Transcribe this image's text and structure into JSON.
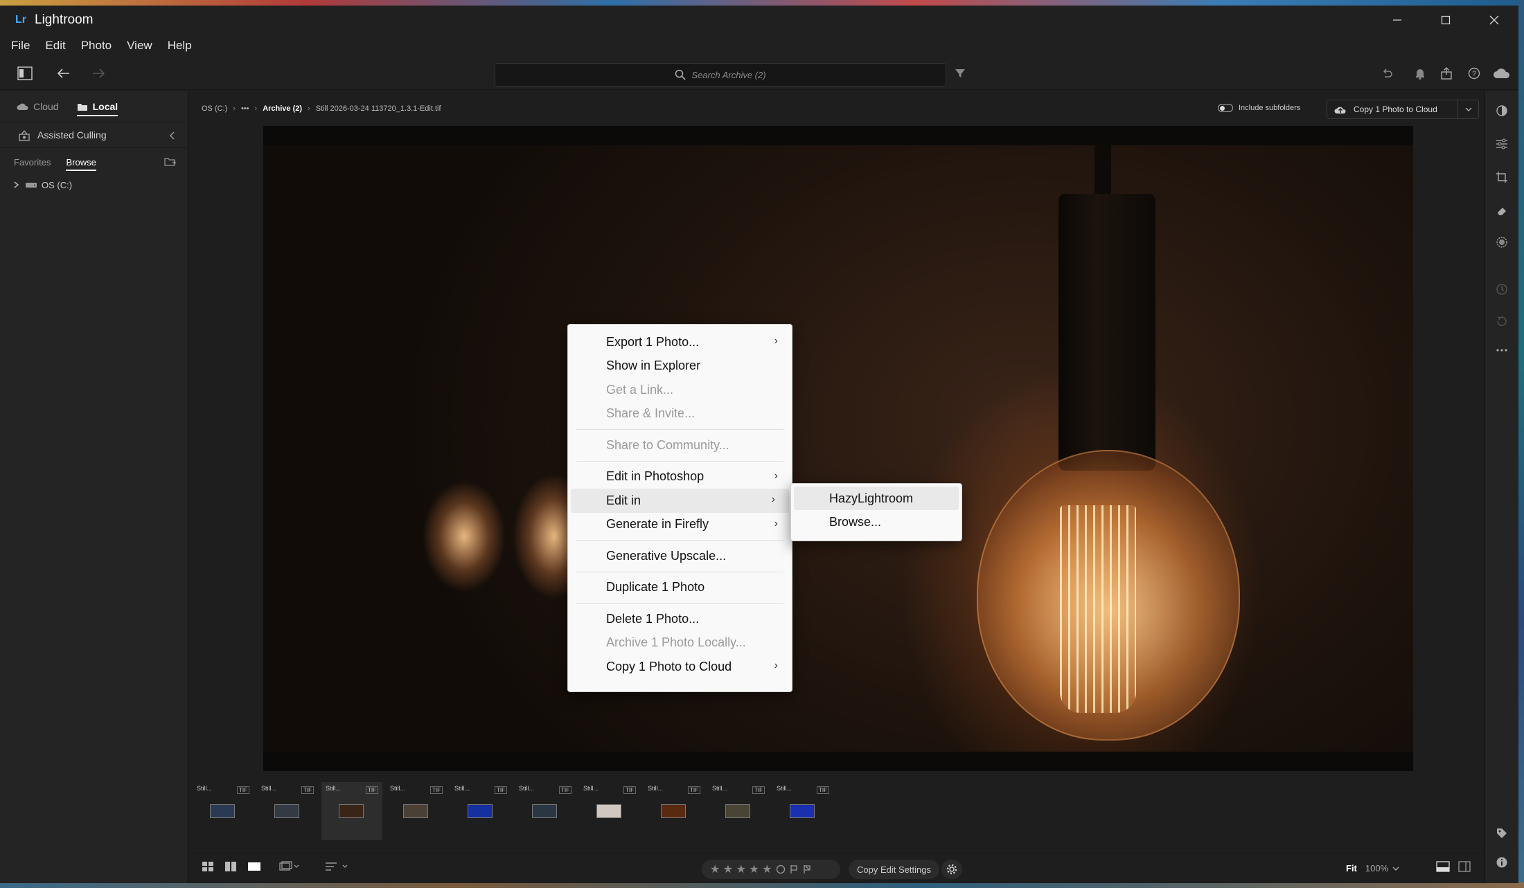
{
  "app": {
    "title": "Lightroom",
    "logo": "Lr"
  },
  "menu": [
    "File",
    "Edit",
    "Photo",
    "View",
    "Help"
  ],
  "search": {
    "placeholder": "Search Archive (2)"
  },
  "left_panel": {
    "tabs": {
      "cloud": "Cloud",
      "local": "Local"
    },
    "assisted_culling": "Assisted Culling",
    "browser_tabs": {
      "favorites": "Favorites",
      "browse": "Browse"
    },
    "tree": {
      "drive": "OS (C:)"
    }
  },
  "breadcrumb": {
    "root": "OS (C:)",
    "more": "•••",
    "folder": "Archive (2)",
    "file": "Still 2026-03-24 113720_1.3.1-Edit.tif"
  },
  "header": {
    "include_subfolders": "Include subfolders",
    "copy_to_cloud": "Copy 1 Photo to Cloud"
  },
  "context_menu": {
    "items": [
      {
        "label": "Export 1 Photo...",
        "submenu": true,
        "disabled": false
      },
      {
        "label": "Show in Explorer",
        "disabled": false
      },
      {
        "label": "Get a Link...",
        "disabled": true
      },
      {
        "label": "Share & Invite...",
        "disabled": true
      },
      {
        "label": "Share to Community...",
        "disabled": true
      },
      {
        "label": "Edit in Photoshop",
        "submenu": true,
        "disabled": false
      },
      {
        "label": "Edit in",
        "submenu": true,
        "disabled": false,
        "highlighted": true
      },
      {
        "label": "Generate in Firefly",
        "submenu": true,
        "disabled": false
      },
      {
        "label": "Generative Upscale...",
        "disabled": false
      },
      {
        "label": "Duplicate 1 Photo",
        "disabled": false
      },
      {
        "label": "Delete 1 Photo...",
        "disabled": false
      },
      {
        "label": "Archive 1 Photo Locally...",
        "disabled": true
      },
      {
        "label": "Copy 1 Photo to Cloud",
        "submenu": true,
        "disabled": false
      }
    ]
  },
  "submenu": {
    "items": [
      {
        "label": "HazyLightroom",
        "highlighted": true
      },
      {
        "label": "Browse..."
      }
    ]
  },
  "filmstrip": {
    "thumbs": [
      {
        "name": "Still...",
        "type": "TIF",
        "color": "#2a3a55"
      },
      {
        "name": "Still...",
        "type": "TIF",
        "color": "#333a44"
      },
      {
        "name": "Still...",
        "type": "TIF",
        "color": "#3a2418",
        "selected": true
      },
      {
        "name": "Still...",
        "type": "TIF",
        "color": "#4a4034"
      },
      {
        "name": "Still...",
        "type": "TIF",
        "color": "#1530a0"
      },
      {
        "name": "Still...",
        "type": "TIF",
        "color": "#2a3644"
      },
      {
        "name": "Still...",
        "type": "TIF",
        "color": "#d0c8c0"
      },
      {
        "name": "Still...",
        "type": "TIF",
        "color": "#5a2a10"
      },
      {
        "name": "Still...",
        "type": "TIF",
        "color": "#4a4434"
      },
      {
        "name": "Still...",
        "type": "TIF",
        "color": "#1a30b0"
      }
    ]
  },
  "bottom_bar": {
    "rating_stars": "★ ★ ★ ★ ★",
    "copy_edit_settings": "Copy Edit Settings",
    "fit": "Fit",
    "zoom": "100%"
  }
}
